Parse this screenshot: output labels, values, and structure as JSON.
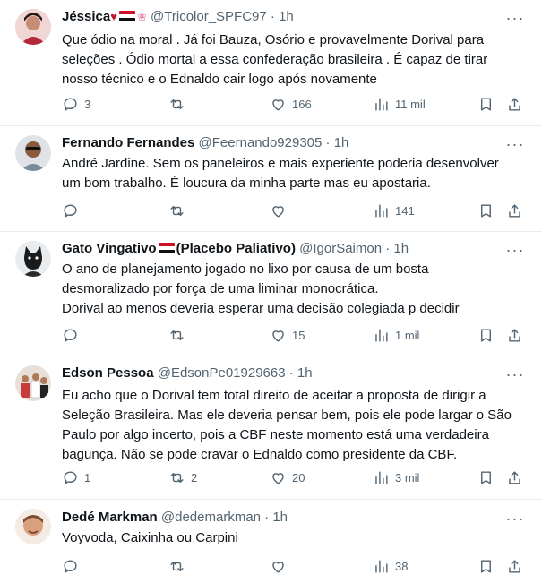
{
  "tweets": [
    {
      "name": "Jéssica",
      "handle": "@Tricolor_SPFC97",
      "time": "1h",
      "text": [
        "Que ódio na moral . Já foi Bauza, Osório e provavelmente Dorival para",
        "seleções . Ódio mortal a essa confederação brasileira . É capaz de tirar",
        "nosso técnico e o Ednaldo cair logo após novamente"
      ],
      "replies": "3",
      "reposts": "",
      "likes": "166",
      "views": "11 mil"
    },
    {
      "name": "Fernando Fernandes",
      "handle": "@Feernando929305",
      "time": "1h",
      "text": [
        "André Jardine. Sem os paneleiros e mais experiente poderia desenvolver",
        "um bom trabalho. É loucura da minha parte mas eu apostaria."
      ],
      "replies": "",
      "reposts": "",
      "likes": "",
      "views": "141"
    },
    {
      "name": "Gato Vingativo",
      "name_suffix": "(Placebo Paliativo)",
      "handle": "@IgorSaimon",
      "time": "1h",
      "text": [
        "O ano de planejamento jogado no lixo por causa de um bosta",
        "desmoralizado por força de uma liminar monocrática.",
        "Dorival ao menos deveria esperar uma decisão colegiada p decidir"
      ],
      "replies": "",
      "reposts": "",
      "likes": "15",
      "views": "1 mil"
    },
    {
      "name": "Edson Pessoa",
      "handle": "@EdsonPe01929663",
      "time": "1h",
      "text": [
        "Eu acho que o Dorival tem total direito de aceitar a proposta de dirigir a",
        "Seleção Brasileira. Mas ele deveria pensar bem, pois ele pode largar o São",
        "Paulo por algo incerto, pois a CBF neste momento está uma verdadeira",
        "bagunça. Não se pode cravar o Ednaldo como presidente da CBF."
      ],
      "replies": "1",
      "reposts": "2",
      "likes": "20",
      "views": "3 mil"
    },
    {
      "name": "Dedé Markman",
      "handle": "@dedemarkman",
      "time": "1h",
      "text": [
        "Voyvoda, Caixinha ou Carpini"
      ],
      "replies": "",
      "reposts": "",
      "likes": "",
      "views": "38"
    }
  ],
  "colors": {
    "text": "#0f1419",
    "muted": "#536471",
    "divider": "#e6ecf0"
  },
  "icons": [
    "reply-icon",
    "repost-icon",
    "like-icon",
    "views-icon",
    "bookmark-icon",
    "share-icon",
    "more-icon"
  ]
}
